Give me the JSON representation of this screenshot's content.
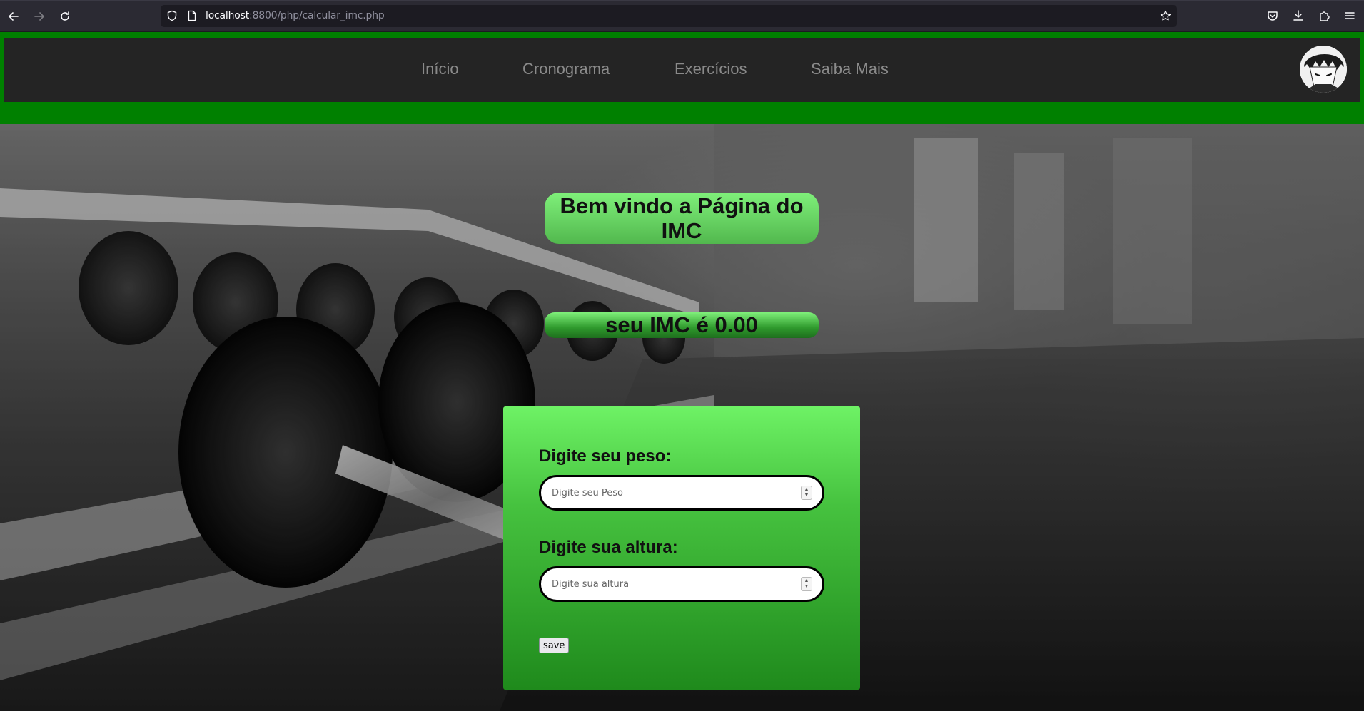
{
  "browser": {
    "url_host": "localhost",
    "url_rest": ":8800/php/calcular_imc.php"
  },
  "nav": {
    "items": [
      {
        "label": "Início"
      },
      {
        "label": "Cronograma"
      },
      {
        "label": "Exercícios"
      },
      {
        "label": "Saiba Mais"
      }
    ]
  },
  "main": {
    "title": "Bem vindo a Página do IMC",
    "result": "seu IMC é 0.00"
  },
  "form": {
    "weight_label": "Digite seu peso:",
    "weight_placeholder": "Digite seu Peso",
    "height_label": "Digite sua altura:",
    "height_placeholder": "Digite sua altura",
    "save_label": "save"
  },
  "colors": {
    "header_green": "#008000",
    "header_dark": "#242424",
    "card_green": "#46c23f"
  }
}
